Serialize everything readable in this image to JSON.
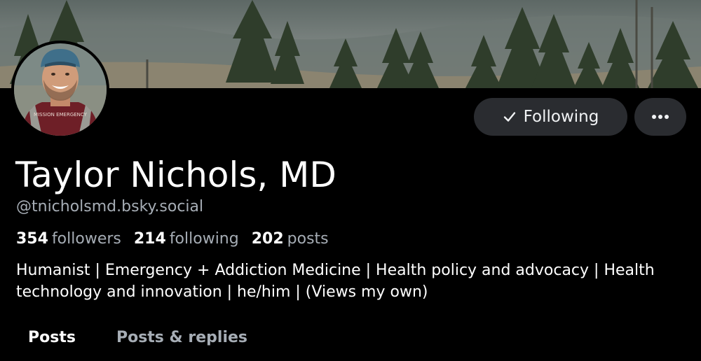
{
  "profile": {
    "name": "Taylor Nichols, MD",
    "handle": "@tnicholsmd.bsky.social",
    "followers_count": "354",
    "followers_label": "followers",
    "following_count": "214",
    "following_label": "following",
    "posts_count": "202",
    "posts_label": "posts",
    "bio": "Humanist | Emergency + Addiction Medicine | Health policy and advocacy | Health technology and innovation | he/him | (Views my own)",
    "avatar_shirt_text": "MISSION EMERGENCY"
  },
  "actions": {
    "following_label": "Following",
    "following_icon": "check-icon",
    "more_icon": "ellipsis-icon"
  },
  "tabs": [
    {
      "label": "Posts"
    },
    {
      "label": "Posts & replies"
    }
  ],
  "colors": {
    "background": "#000000",
    "text_primary": "#ffffff",
    "text_secondary": "#a6adb5",
    "button_bg": "#2a2c30"
  }
}
